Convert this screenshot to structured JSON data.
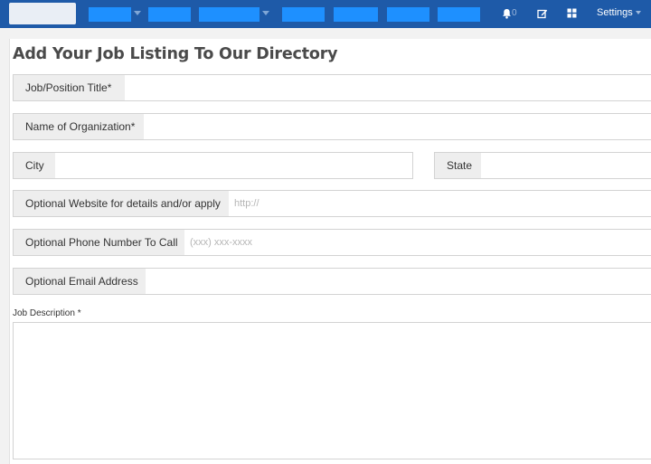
{
  "nav": {
    "bell_count": "0",
    "settings_label": "Settings",
    "icons": [
      "bell-icon",
      "edit-icon",
      "grid-icon"
    ],
    "colors": {
      "bar": "#1e5aa8",
      "item": "#1e90ff"
    }
  },
  "page": {
    "title": "Add Your Job Listing To Our Directory"
  },
  "form": {
    "job_title": {
      "label": "Job/Position Title*",
      "value": "",
      "placeholder": ""
    },
    "organization": {
      "label": "Name of Organization*",
      "value": "",
      "placeholder": ""
    },
    "city": {
      "label": "City",
      "value": "",
      "placeholder": ""
    },
    "state": {
      "label": "State",
      "value": "",
      "placeholder": ""
    },
    "website": {
      "label": "Optional Website for details and/or apply",
      "value": "",
      "placeholder": "http://"
    },
    "phone": {
      "label": "Optional Phone Number To Call",
      "value": "",
      "placeholder": "(xxx) xxx-xxxx"
    },
    "email": {
      "label": "Optional Email Address",
      "value": "",
      "placeholder": ""
    },
    "description": {
      "label": "Job Description *",
      "value": ""
    }
  }
}
